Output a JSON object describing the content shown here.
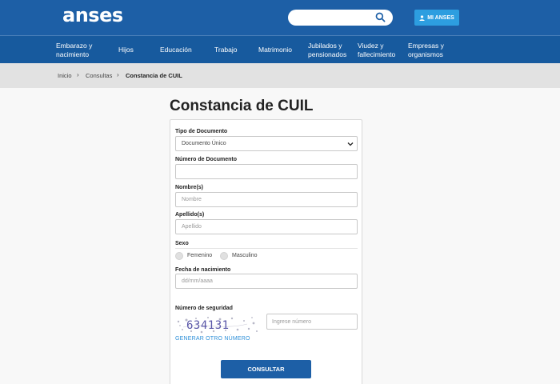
{
  "header": {
    "logo": "anses",
    "search_placeholder": "",
    "account_label": "MI ANSES"
  },
  "nav": {
    "items": [
      {
        "label_line1": "Embarazo y",
        "label_line2": "nacimiento"
      },
      {
        "label_line1": "Hijos",
        "label_line2": ""
      },
      {
        "label_line1": "Educación",
        "label_line2": ""
      },
      {
        "label_line1": "Trabajo",
        "label_line2": ""
      },
      {
        "label_line1": "Matrimonio",
        "label_line2": ""
      },
      {
        "label_line1": "Jubilados y",
        "label_line2": "pensionados"
      },
      {
        "label_line1": "Viudez y",
        "label_line2": "fallecimiento"
      },
      {
        "label_line1": "Empresas y",
        "label_line2": "organismos"
      }
    ]
  },
  "breadcrumb": {
    "items": [
      "Inicio",
      "Consultas",
      "Constancia de CUIL"
    ],
    "separator": "›"
  },
  "page": {
    "title": "Constancia de CUIL"
  },
  "form": {
    "tipo_documento": {
      "label": "Tipo de Documento",
      "value": "Documento Único"
    },
    "numero_documento": {
      "label": "Número de Documento",
      "placeholder": ""
    },
    "nombre": {
      "label": "Nombre(s)",
      "placeholder": "Nombre"
    },
    "apellido": {
      "label": "Apellido(s)",
      "placeholder": "Apellido"
    },
    "sexo": {
      "label": "Sexo",
      "options": [
        "Femenino",
        "Masculino"
      ]
    },
    "fecha_nacimiento": {
      "label": "Fecha de nacimiento",
      "placeholder": "dd/mm/aaaa"
    },
    "seguridad": {
      "label": "Número de seguridad",
      "captcha_text": "634131",
      "input_placeholder": "Ingrese número",
      "regenerate_label": "GENERAR OTRO NÚMERO"
    },
    "submit_label": "CONSULTAR"
  },
  "colors": {
    "header_bg": "#1d5fa6",
    "nav_bg": "#175a9e",
    "account_button": "#2d9ee0",
    "link": "#2d8fd8"
  }
}
